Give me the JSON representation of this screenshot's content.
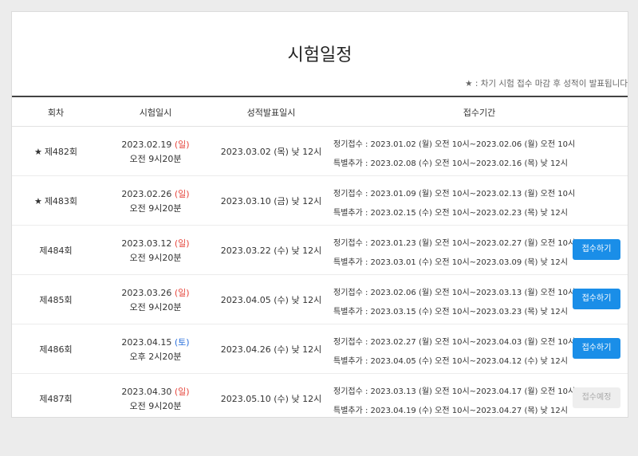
{
  "page_title": "시험일정",
  "notice": "★ : 차기 시험 접수 마감 후 성적이 발표됩니다",
  "headers": {
    "round": "회차",
    "exam_date": "시험일시",
    "result_date": "성적발표일시",
    "period": "접수기간"
  },
  "rows": [
    {
      "star": "★",
      "round": "제482회",
      "exam_date": "2023.02.19",
      "exam_day": "(일)",
      "exam_day_color": "#e5443a",
      "exam_time": "오전 9시20분",
      "result": "2023.03.02 (목) 낮 12시",
      "regular": "정기접수 : 2023.01.02 (월) 오전 10시~2023.02.06 (월) 오전 10시",
      "extra": "특별추가 : 2023.02.08 (수) 오전 10시~2023.02.16 (목) 낮 12시",
      "button": ""
    },
    {
      "star": "★",
      "round": "제483회",
      "exam_date": "2023.02.26",
      "exam_day": "(일)",
      "exam_day_color": "#e5443a",
      "exam_time": "오전 9시20분",
      "result": "2023.03.10 (금) 낮 12시",
      "regular": "정기접수 : 2023.01.09 (월) 오전 10시~2023.02.13 (월) 오전 10시",
      "extra": "특별추가 : 2023.02.15 (수) 오전 10시~2023.02.23 (목) 낮 12시",
      "button": ""
    },
    {
      "star": "",
      "round": "제484회",
      "exam_date": "2023.03.12",
      "exam_day": "(일)",
      "exam_day_color": "#e5443a",
      "exam_time": "오전 9시20분",
      "result": "2023.03.22 (수) 낮 12시",
      "regular": "정기접수 : 2023.01.23 (월) 오전 10시~2023.02.27 (월) 오전 10시",
      "extra": "특별추가 : 2023.03.01 (수) 오전 10시~2023.03.09 (목) 낮 12시",
      "button": "접수하기"
    },
    {
      "star": "",
      "round": "제485회",
      "exam_date": "2023.03.26",
      "exam_day": "(일)",
      "exam_day_color": "#e5443a",
      "exam_time": "오전 9시20분",
      "result": "2023.04.05 (수) 낮 12시",
      "regular": "정기접수 : 2023.02.06 (월) 오전 10시~2023.03.13 (월) 오전 10시",
      "extra": "특별추가 : 2023.03.15 (수) 오전 10시~2023.03.23 (목) 낮 12시",
      "button": "접수하기"
    },
    {
      "star": "",
      "round": "제486회",
      "exam_date": "2023.04.15",
      "exam_day": "(토)",
      "exam_day_color": "#2a6fdb",
      "exam_time": "오후 2시20분",
      "result": "2023.04.26 (수) 낮 12시",
      "regular": "정기접수 : 2023.02.27 (월) 오전 10시~2023.04.03 (월) 오전 10시",
      "extra": "특별추가 : 2023.04.05 (수) 오전 10시~2023.04.12 (수) 낮 12시",
      "button": "접수하기"
    },
    {
      "star": "",
      "round": "제487회",
      "exam_date": "2023.04.30",
      "exam_day": "(일)",
      "exam_day_color": "#e5443a",
      "exam_time": "오전 9시20분",
      "result": "2023.05.10 (수) 낮 12시",
      "regular": "정기접수 : 2023.03.13 (월) 오전 10시~2023.04.17 (월) 오전 10시",
      "extra": "특별추가 : 2023.04.19 (수) 오전 10시~2023.04.27 (목) 낮 12시",
      "button": "접수예정"
    }
  ],
  "colors": {
    "button_active": "#1a8ee8",
    "button_disabled": "#eeeeee",
    "sunday": "#e5443a",
    "saturday": "#2a6fdb"
  }
}
